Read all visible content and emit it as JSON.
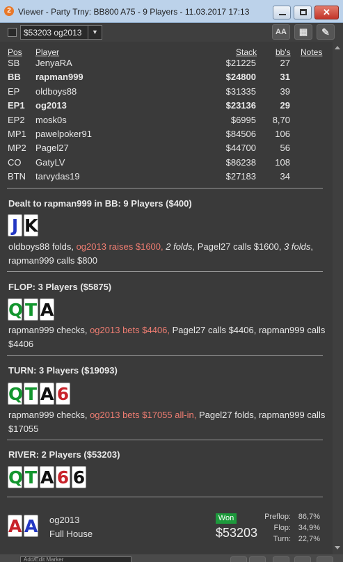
{
  "window": {
    "app_icon_glyph": "2",
    "title": "Viewer - Party Trny: BB800 A75 - 9 Players - 11.03.2017 17:13",
    "min_icon": "minimize-icon",
    "max_icon": "maximize-icon",
    "close_glyph": "✕"
  },
  "toolbar": {
    "player_select_value": "$53203 og2013",
    "dropdown_arrow": "▼",
    "font_size_label": "AA",
    "grid_glyph": "▦",
    "edit_glyph": "✎"
  },
  "table": {
    "headers": {
      "pos": "Pos",
      "player": "Player",
      "stack": "Stack",
      "bbs": "bb's",
      "notes": "Notes"
    },
    "rows": [
      {
        "pos": "SB",
        "player": "JenyaRA",
        "stack": "$21225",
        "bbs": "27",
        "bold": false
      },
      {
        "pos": "BB",
        "player": "rapman999",
        "stack": "$24800",
        "bbs": "31",
        "bold": true
      },
      {
        "pos": "EP",
        "player": "oldboys88",
        "stack": "$31335",
        "bbs": "39",
        "bold": false
      },
      {
        "pos": "EP1",
        "player": "og2013",
        "stack": "$23136",
        "bbs": "29",
        "bold": true
      },
      {
        "pos": "EP2",
        "player": "mosk0s",
        "stack": "$6995",
        "bbs": "8,70",
        "bold": false
      },
      {
        "pos": "MP1",
        "player": "pawelpoker91",
        "stack": "$84506",
        "bbs": "106",
        "bold": false
      },
      {
        "pos": "MP2",
        "player": "Pagel27",
        "stack": "$44700",
        "bbs": "56",
        "bold": false
      },
      {
        "pos": "CO",
        "player": "GatyLV",
        "stack": "$86238",
        "bbs": "108",
        "bold": false
      },
      {
        "pos": "BTN",
        "player": "tarvydas19",
        "stack": "$27183",
        "bbs": "34",
        "bold": false
      }
    ]
  },
  "preflop": {
    "title": "Dealt to rapman999 in BB: 9 Players ($400)",
    "cards": [
      {
        "rank": "J",
        "suit": "d"
      },
      {
        "rank": "K",
        "suit": "s"
      }
    ],
    "actions": {
      "a1": "oldboys88 folds, ",
      "a2": "og2013 raises $1600, ",
      "a3": "2 folds",
      "a4": ", Pagel27 calls $1600, ",
      "a5": "3 folds",
      "a6": ", rapman999 calls $800"
    }
  },
  "flop": {
    "title": "FLOP: 3 Players ($5875)",
    "cards": [
      {
        "rank": "Q",
        "suit": "c"
      },
      {
        "rank": "T",
        "suit": "c"
      },
      {
        "rank": "A",
        "suit": "s"
      }
    ],
    "actions": {
      "a1": "rapman999 checks, ",
      "a2": "og2013 bets $4406, ",
      "a3": "Pagel27 calls $4406, rapman999 calls $4406"
    }
  },
  "turn": {
    "title": "TURN: 3 Players ($19093)",
    "cards": [
      {
        "rank": "Q",
        "suit": "c"
      },
      {
        "rank": "T",
        "suit": "c"
      },
      {
        "rank": "A",
        "suit": "s"
      },
      {
        "rank": "6",
        "suit": "h"
      }
    ],
    "actions": {
      "a1": "rapman999 checks, ",
      "a2": "og2013 bets $17055 all-in, ",
      "a3": "Pagel27 folds, rapman999 calls $17055"
    }
  },
  "river": {
    "title": "RIVER: 2 Players ($53203)",
    "cards": [
      {
        "rank": "Q",
        "suit": "c"
      },
      {
        "rank": "T",
        "suit": "c"
      },
      {
        "rank": "A",
        "suit": "s"
      },
      {
        "rank": "6",
        "suit": "h"
      },
      {
        "rank": "6",
        "suit": "s"
      }
    ]
  },
  "result": {
    "cards": [
      {
        "rank": "A",
        "suit": "h"
      },
      {
        "rank": "A",
        "suit": "d"
      }
    ],
    "winner": "og2013",
    "hand": "Full House",
    "won_label": "Won",
    "amount": "$53203",
    "equity": [
      {
        "label": "Preflop:",
        "value": "86,7%"
      },
      {
        "label": "Flop:",
        "value": "34,9%"
      },
      {
        "label": "Turn:",
        "value": "22,7%"
      }
    ]
  },
  "bottom": {
    "input_text": "Add/Edit Marker"
  },
  "colors": {
    "highlight_action": "#ef7d72",
    "won_badge": "#1d9a3c",
    "suit_spade": "#111111",
    "suit_heart": "#c8232b",
    "suit_diamond": "#2438c4",
    "suit_club": "#14962f"
  }
}
